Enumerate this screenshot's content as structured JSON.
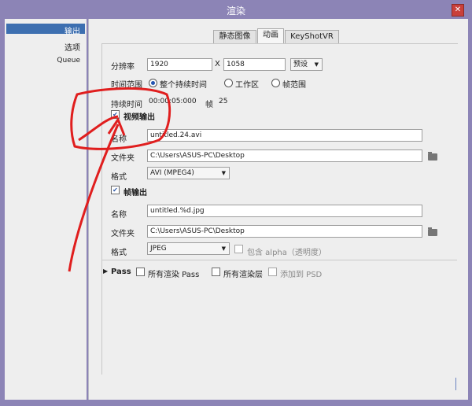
{
  "window": {
    "title": "渲染"
  },
  "sidebar": {
    "items": [
      {
        "label": "输出"
      },
      {
        "label": "选项"
      },
      {
        "label": "Queue"
      }
    ]
  },
  "tabs": [
    {
      "label": "静态图像"
    },
    {
      "label": "动画"
    },
    {
      "label": "KeyShotVR"
    }
  ],
  "resolution": {
    "label": "分辨率",
    "width": "1920",
    "x_sep": "X",
    "height": "1058",
    "preset_label": "预设"
  },
  "time_range": {
    "label": "时间范围",
    "options": [
      {
        "label": "整个持续时间"
      },
      {
        "label": "工作区"
      },
      {
        "label": "帧范围"
      }
    ]
  },
  "duration": {
    "label": "持续时间",
    "value": "00:00:05:000",
    "frames_label": "帧",
    "frames_value": "25"
  },
  "video_output": {
    "label": "视频输出",
    "name_label": "名称",
    "name_value": "untitled.24.avi",
    "folder_label": "文件夹",
    "folder_value": "C:\\Users\\ASUS-PC\\Desktop",
    "format_label": "格式",
    "format_value": "AVI (MPEG4)"
  },
  "frame_output": {
    "label": "帧输出",
    "name_label": "名称",
    "name_value": "untitled.%d.jpg",
    "folder_label": "文件夹",
    "folder_value": "C:\\Users\\ASUS-PC\\Desktop",
    "format_label": "格式",
    "format_value": "JPEG",
    "alpha_label": "包含 alpha（透明度）"
  },
  "pass": {
    "label": "Pass",
    "all_passes_label": "所有渲染 Pass",
    "all_layers_label": "所有渲染层",
    "add_psd_label": "添加到 PSD"
  },
  "colors": {
    "titlebar": "#8c84b6",
    "selection": "#3d6fb0",
    "annotation": "#e01e1e",
    "close": "#c9403a"
  }
}
